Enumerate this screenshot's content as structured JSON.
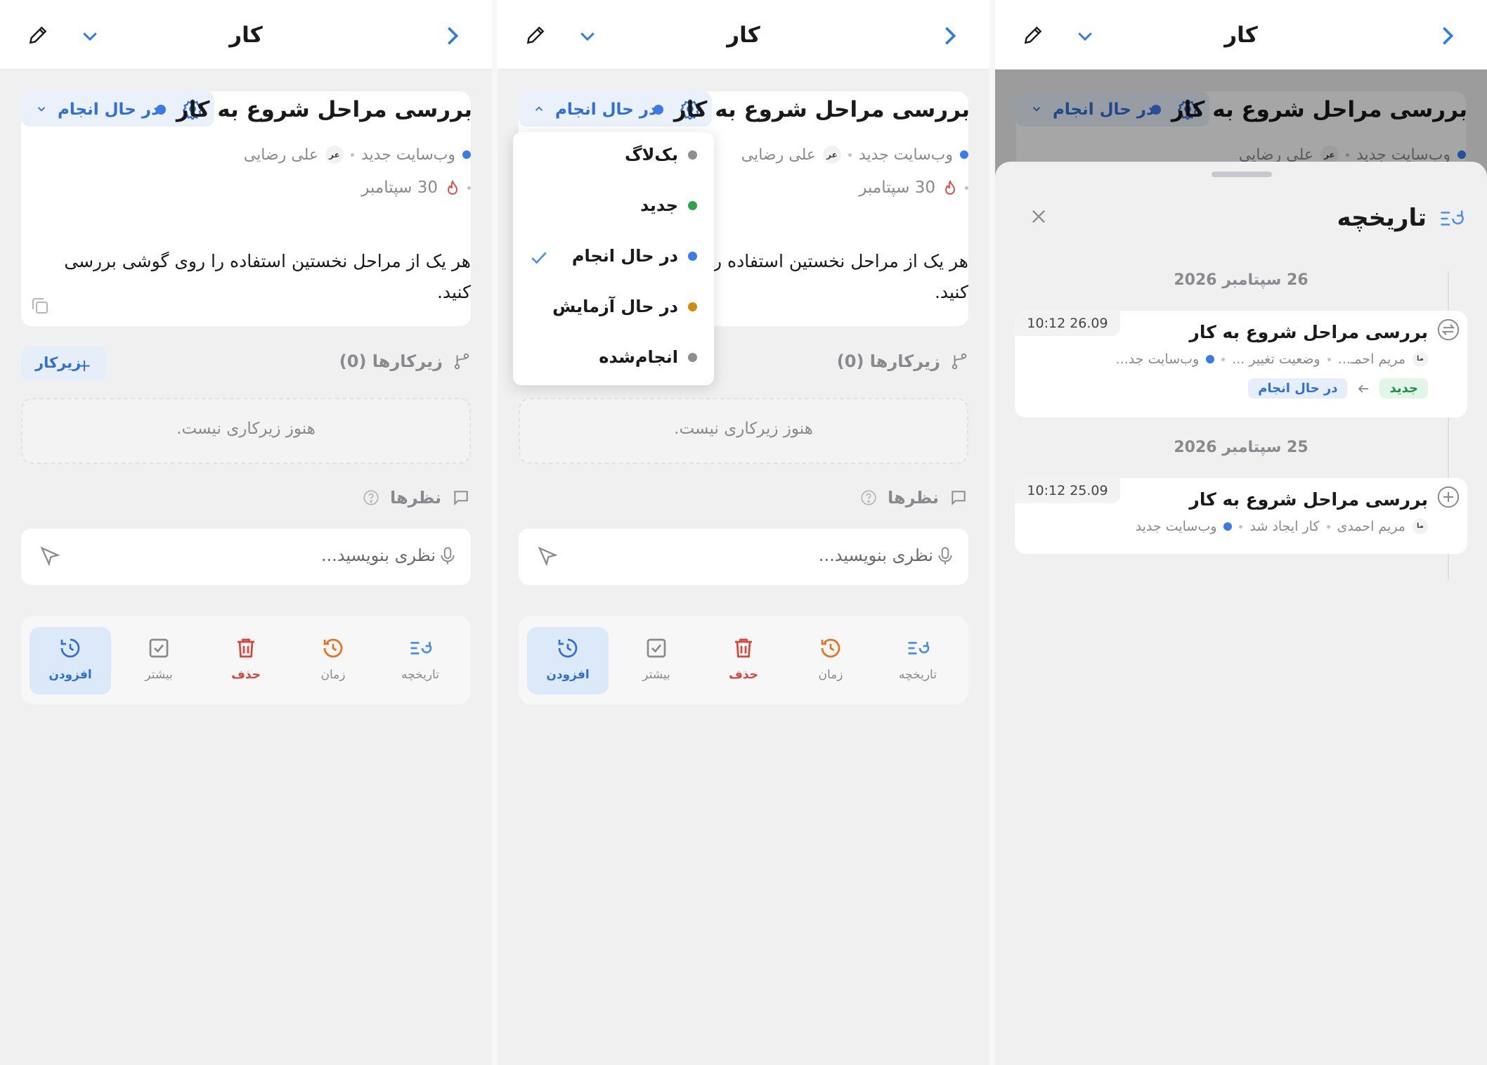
{
  "header": {
    "title": "کار"
  },
  "task": {
    "title": "بررسی مراحل شروع به کار",
    "status": "در حال انجام",
    "project": "وب‌سایت جدید",
    "assignee_initials": "عر",
    "assignee": "علی رضایی",
    "due": "30 سپتامبر",
    "description": "هر یک از مراحل نخستین استفاده را روی گوشی بررسی کنید."
  },
  "subtasks": {
    "heading": "زیرکارها (0)",
    "add_label": "زیرکار",
    "empty": "هنوز زیرکاری نیست."
  },
  "comments": {
    "heading": "نظرها",
    "placeholder": "نظری بنویسید..."
  },
  "actions": [
    {
      "label": "افزودن",
      "icon": "add-time-icon",
      "color": "#2f6fd6"
    },
    {
      "label": "بیشتر",
      "icon": "checkbox-icon",
      "color": "#8a8a8e"
    },
    {
      "label": "حذف",
      "icon": "trash-icon",
      "color": "#d9443b"
    },
    {
      "label": "زمان",
      "icon": "clock-history-icon",
      "color": "#e8731c"
    },
    {
      "label": "تاریخچه",
      "icon": "history-list-icon",
      "color": "#4a90e2"
    }
  ],
  "status_menu": {
    "options": [
      {
        "label": "بک‌لاگ",
        "color": "#8e8e93"
      },
      {
        "label": "جدید",
        "color": "#2ea44f"
      },
      {
        "label": "در حال انجام",
        "color": "#3b7be8",
        "selected": true
      },
      {
        "label": "در حال آزمایش",
        "color": "#d18a12"
      },
      {
        "label": "انجام‌شده",
        "color": "#8e8e93"
      }
    ]
  },
  "history": {
    "title": "تاریخچه",
    "groups": [
      {
        "date": "26 سپتامبر 2026",
        "entry": {
          "time": "10:12 26.09",
          "title": "بررسی مراحل شروع به کار",
          "user_initials": "ما",
          "user": "مریم احمـ...",
          "action": "وضعیت تغییر ...",
          "project": "وب‌سایت جد...",
          "from": "جدید",
          "to": "در حال انجام"
        }
      },
      {
        "date": "25 سپتامبر 2026",
        "entry": {
          "time": "10:12 25.09",
          "title": "بررسی مراحل شروع به کار",
          "user_initials": "ما",
          "user": "مریم احمدی",
          "action": "کار ایجاد شد",
          "project": "وب‌سایت جدید"
        }
      }
    ]
  }
}
